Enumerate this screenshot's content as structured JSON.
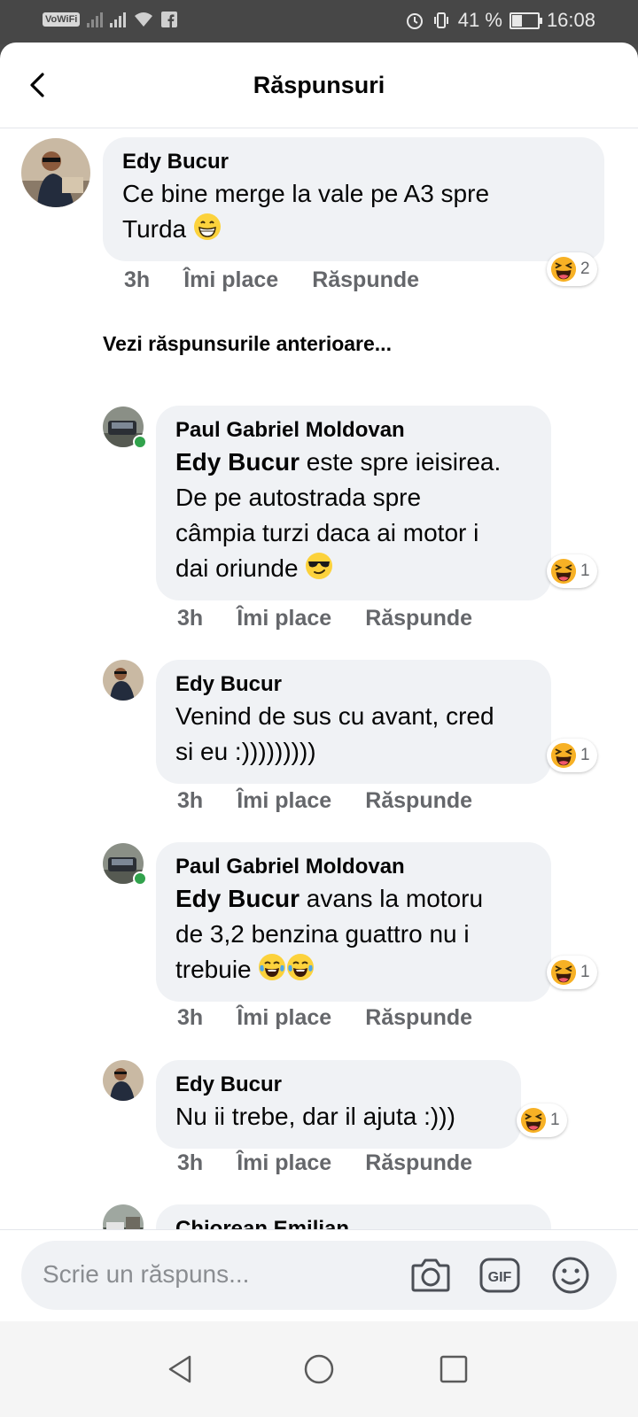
{
  "status_bar": {
    "vowifi": "VoWiFi",
    "battery_percent": "41 %",
    "battery_level": 0.41,
    "time": "16:08"
  },
  "header": {
    "title": "Răspunsuri"
  },
  "main_comment": {
    "author": "Edy Bucur",
    "text": "Ce bine merge la vale pe A3 spre Turda",
    "time": "3h",
    "like_label": "Îmi place",
    "reply_label": "Răspunde",
    "reaction_icon": "laughing-emoji",
    "reaction_count": "2"
  },
  "previous_replies_link": "Vezi răspunsurile anterioare...",
  "replies": [
    {
      "author": "Paul Gabriel Moldovan",
      "mention": "Edy Bucur",
      "text_line1_rest": " este spre ieisirea.",
      "text_line2": "De pe autostrada  spre",
      "text_line3": "câmpia turzi daca ai motor i",
      "text_line4": "dai oriunde",
      "time": "3h",
      "like_label": "Îmi place",
      "reply_label": "Răspunde",
      "reaction_count": "1",
      "online": true
    },
    {
      "author": "Edy Bucur",
      "text_line1": "Venind de sus cu avant, cred",
      "text_line2": "si eu :)))))))))",
      "time": "3h",
      "like_label": "Îmi place",
      "reply_label": "Răspunde",
      "reaction_count": "1"
    },
    {
      "author": "Paul Gabriel Moldovan",
      "mention": "Edy Bucur",
      "text_line1_rest": " avans la motoru",
      "text_line2": "de 3,2 benzina  guattro nu i",
      "text_line3": "trebuie",
      "time": "3h",
      "like_label": "Îmi place",
      "reply_label": "Răspunde",
      "reaction_count": "1",
      "online": true
    },
    {
      "author": "Edy Bucur",
      "text_line1": "Nu ii trebe, dar il ajuta :)))",
      "time": "3h",
      "like_label": "Îmi place",
      "reply_label": "Răspunde",
      "reaction_count": "1"
    },
    {
      "author": "Chiorean Emilian"
    }
  ],
  "composer": {
    "placeholder": "Scrie un răspuns...",
    "icons": [
      "camera-icon",
      "gif-icon",
      "emoji-icon"
    ]
  },
  "nav": {
    "icons": [
      "back-nav-icon",
      "home-nav-icon",
      "recents-nav-icon"
    ]
  },
  "colors": {
    "bubble": "#f0f2f5",
    "meta": "#65676b",
    "online": "#31a24c"
  }
}
